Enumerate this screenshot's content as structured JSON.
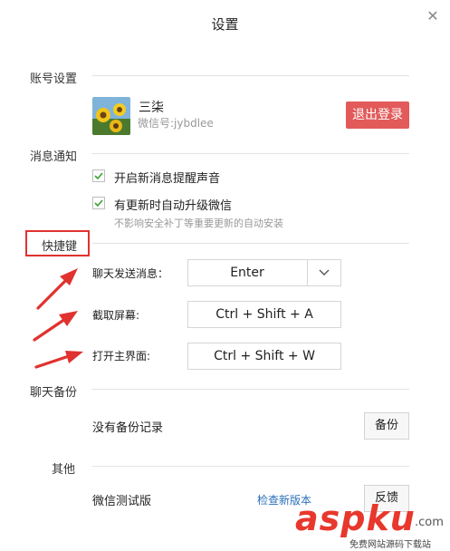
{
  "window": {
    "title": "设置",
    "close_icon": "close-icon"
  },
  "account": {
    "section_label": "账号设置",
    "nickname": "三柒",
    "wechat_id": "微信号:jybdlee",
    "logout_label": "退出登录",
    "logout_color": "#e25a5a"
  },
  "notifications": {
    "section_label": "消息通知",
    "items": [
      {
        "label": "开启新消息提醒声音",
        "checked": true
      },
      {
        "label": "有更新时自动升级微信",
        "checked": true
      }
    ],
    "hint": "不影响安全补丁等重要更新的自动安装"
  },
  "shortcuts": {
    "section_label": "快捷键",
    "send_label": "聊天发送消息：",
    "send_value": "Enter",
    "screenshot_label": "截取屏幕:",
    "screenshot_value": "Ctrl + Shift + A",
    "open_label": "打开主界面:",
    "open_value": "Ctrl + Shift + W",
    "highlight_color": "#e0322f"
  },
  "backup": {
    "section_label": "聊天备份",
    "status": "没有备份记录",
    "button_label": "备份"
  },
  "other": {
    "section_label": "其他",
    "version": "微信测试版",
    "check_update": "检查新版本",
    "feedback_label": "反馈"
  },
  "watermark": {
    "text": "aspku",
    "suffix": ".com",
    "caption": "免费网站源码下载站"
  }
}
